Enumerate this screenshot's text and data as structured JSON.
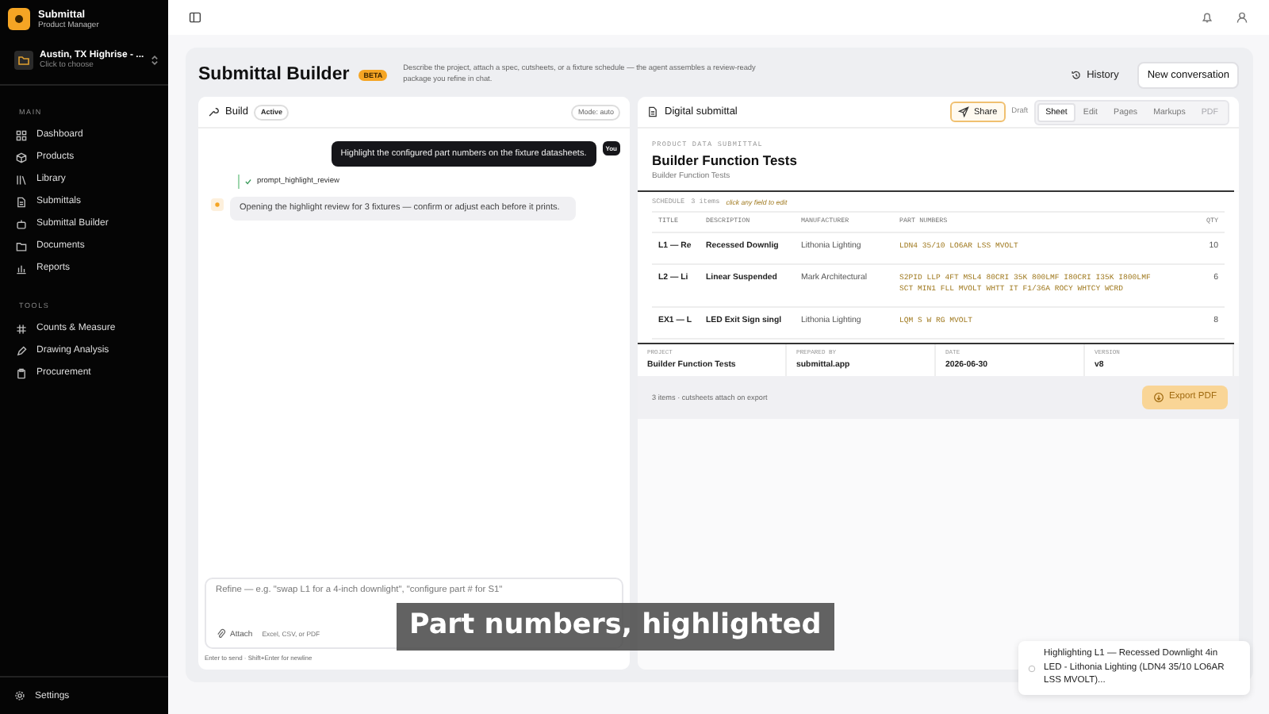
{
  "sidebar": {
    "app_name": "Submittal",
    "role": "Product Manager",
    "project": {
      "name": "Austin, TX Highrise - ...",
      "hint": "Click to choose"
    },
    "sections": [
      {
        "title": "MAIN",
        "items": [
          {
            "label": "Dashboard",
            "selected": false
          },
          {
            "label": "Products",
            "selected": false
          },
          {
            "label": "Library",
            "selected": false
          },
          {
            "label": "Submittals",
            "selected": false
          },
          {
            "label": "Submittal Builder",
            "selected": false
          },
          {
            "label": "Documents",
            "selected": false
          },
          {
            "label": "Reports",
            "selected": false
          }
        ]
      },
      {
        "title": "TOOLS",
        "items": [
          {
            "label": "Counts & Measure",
            "selected": false
          },
          {
            "label": "Drawing Analysis",
            "selected": false
          },
          {
            "label": "Procurement",
            "selected": false
          }
        ]
      }
    ],
    "settings": "Settings"
  },
  "header": {
    "title": "Submittal Builder",
    "badge": "BETA",
    "description": "Describe the project, attach a spec, cutsheets, or a fixture schedule — the agent assembles a review-ready package you refine in chat.",
    "history": "History",
    "new_conversation": "New conversation"
  },
  "build": {
    "title": "Build",
    "status": "Active",
    "mode": "Mode: auto",
    "messages": [
      {
        "kind": "user",
        "text": "Highlight the configured part numbers on the fixture datasheets.",
        "avatar": "You"
      },
      {
        "kind": "tool",
        "text": "prompt_highlight_review"
      },
      {
        "kind": "agent",
        "text": "Opening the highlight review for 3 fixtures — confirm or adjust each before it prints."
      }
    ],
    "input": {
      "placeholder": "Refine — e.g. \"swap L1 for a 4-inch downlight\", \"configure part # for S1\""
    },
    "attach": "Attach",
    "attach_hint": "Excel, CSV, or PDF",
    "footer": "Enter to send · Shift+Enter for newline"
  },
  "submittal": {
    "title": "Digital submittal",
    "share": "Share",
    "state": "Draft",
    "views": [
      {
        "label": "Sheet",
        "selected": true,
        "disabled": false
      },
      {
        "label": "Edit",
        "selected": false,
        "disabled": false
      },
      {
        "label": "Pages",
        "selected": false,
        "disabled": false
      },
      {
        "label": "Markups",
        "selected": false,
        "disabled": false
      },
      {
        "label": "PDF",
        "selected": false,
        "disabled": true
      }
    ],
    "eyebrow": "PRODUCT DATA SUBMITTAL",
    "doc_title": "Builder Function Tests",
    "doc_subtitle": "Builder Function Tests",
    "schedule_label": "SCHEDULE",
    "schedule_count": "3 items",
    "schedule_hint": "click any field to edit",
    "columns": [
      "TITLE",
      "DESCRIPTION",
      "MANUFACTURER",
      "PART NUMBERS",
      "QTY"
    ],
    "rows": [
      {
        "title": "L1 — Re",
        "description": "Recessed Downlig",
        "manufacturer": "Lithonia Lighting",
        "part_numbers": "LDN4 35/10 LO6AR LSS MVOLT",
        "qty": "10"
      },
      {
        "title": "L2 — Li",
        "description": "Linear Suspended",
        "manufacturer": "Mark Architectural",
        "part_numbers": "S2PID LLP 4FT MSL4 80CRI 35K 800LMF I80CRI I35K I800LMF SCT MIN1 FLL MVOLT WHTT IT F1/36A ROCY WHTCY WCRD",
        "qty": "6"
      },
      {
        "title": "EX1 — L",
        "description": "LED Exit Sign singl",
        "manufacturer": "Lithonia Lighting",
        "part_numbers": "LQM S W RG MVOLT",
        "qty": "8"
      }
    ],
    "meta": [
      {
        "label": "PROJECT",
        "value": "Builder Function Tests"
      },
      {
        "label": "PREPARED BY",
        "value": "submittal.app"
      },
      {
        "label": "DATE",
        "value": "2026-06-30"
      },
      {
        "label": "VERSION",
        "value": "v8"
      }
    ],
    "summary": "3 items · cutsheets attach on export",
    "export": "Export PDF"
  },
  "caption": "Part numbers, highlighted",
  "toast": "Highlighting L1 — Recessed Downlight 4in LED - Lithonia Lighting (LDN4 35/10 LO6AR LSS MVOLT)..."
}
